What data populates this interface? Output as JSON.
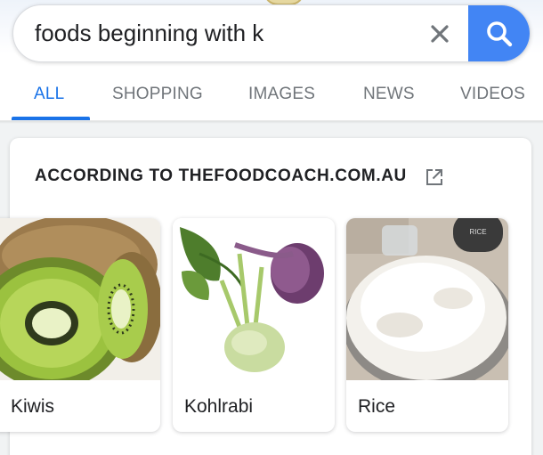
{
  "search": {
    "query": "foods beginning with k"
  },
  "tabs": [
    {
      "label": "ALL",
      "active": true
    },
    {
      "label": "SHOPPING",
      "active": false
    },
    {
      "label": "IMAGES",
      "active": false
    },
    {
      "label": "NEWS",
      "active": false
    },
    {
      "label": "VIDEOS",
      "active": false
    }
  ],
  "card": {
    "source": "ACCORDING TO THEFOODCOACH.COM.AU",
    "items": [
      {
        "label": "Kiwis"
      },
      {
        "label": "Kohlrabi"
      },
      {
        "label": "Rice",
        "container_text": "RICE"
      }
    ]
  },
  "colors": {
    "accent": "#1a73e8",
    "search_button": "#4285f4",
    "tab_inactive": "#70757a",
    "text": "#202124"
  },
  "icons": {
    "clear": "close-icon",
    "search": "search-icon",
    "external": "open-in-new-icon"
  }
}
